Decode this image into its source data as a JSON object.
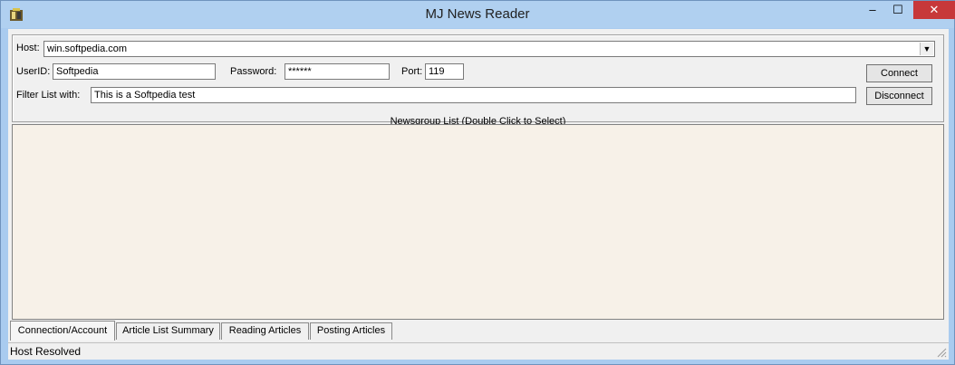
{
  "window": {
    "title": "MJ News Reader",
    "controls": {
      "minimize": "‒",
      "maximize": "☐",
      "close": "✕"
    }
  },
  "connection": {
    "host_label": "Host:",
    "host_value": "win.softpedia.com",
    "userid_label": "UserID:",
    "userid_value": "Softpedia",
    "password_label": "Password:",
    "password_value": "******",
    "port_label": "Port:",
    "port_value": "119",
    "filter_label": "Filter List with:",
    "filter_value": "This is a Softpedia test",
    "connect_label": "Connect",
    "disconnect_label": "Disconnect",
    "newsgroup_caption": "Newsgroup List (Double Click to Select)"
  },
  "tabs": [
    {
      "label": "Connection/Account",
      "active": true
    },
    {
      "label": "Article List Summary",
      "active": false
    },
    {
      "label": "Reading Articles",
      "active": false
    },
    {
      "label": "Posting Articles",
      "active": false
    }
  ],
  "status": {
    "text": "Host Resolved"
  },
  "colors": {
    "close_button": "#c7383a",
    "list_background": "#f7f1e8",
    "frame": "#a9cbef"
  }
}
